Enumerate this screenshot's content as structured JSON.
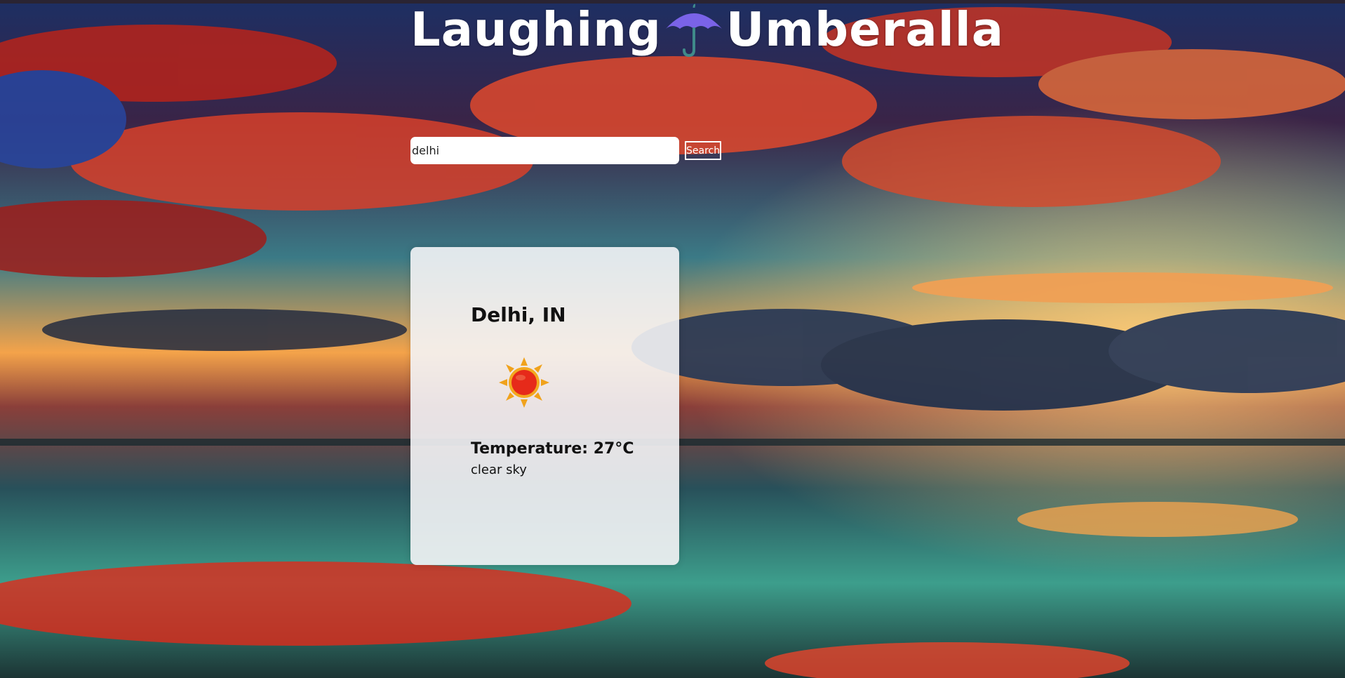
{
  "header": {
    "title_left": "Laughing",
    "title_icon": "umbrella-icon",
    "title_right": "Umberalla"
  },
  "search": {
    "value": "delhi",
    "button_label": "Search"
  },
  "weather": {
    "location": "Delhi, IN",
    "icon": "sun-icon",
    "temperature_label": "Temperature:",
    "temperature_value": "27°C",
    "description": "clear sky"
  },
  "colors": {
    "title": "#ffffff",
    "card_background": "#f4f4f6",
    "sun_core": "#e62a1a",
    "sun_rays": "#f0a21c",
    "umbrella_canopy": "#7a63e8",
    "umbrella_handle": "#3f8a8a"
  }
}
